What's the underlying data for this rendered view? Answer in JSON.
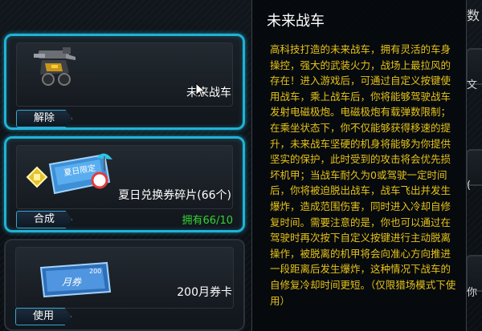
{
  "items": [
    {
      "name": "未来战车",
      "button_label": "解除",
      "icon": "mech-vehicle-icon",
      "selected": true
    },
    {
      "name": "夏日兑换券碎片(66个)",
      "button_label": "合成",
      "owned_label": "拥有66/10",
      "icon": "summer-voucher-fragment-icon",
      "badge_text": "夏日限定",
      "selected": true
    },
    {
      "name": "200月券卡",
      "button_label": "使用",
      "icon": "monthly-voucher-card-icon",
      "badge_text": "月券",
      "badge_number": "200",
      "selected": false
    }
  ],
  "tooltip": {
    "title": "未来战车",
    "description": "高科技打造的未来战车，拥有灵活的车身操控，强大的武装火力，战场上最拉风的存在！进入游戏后，可通过自定义按键使用战车，乘上战车后，你将能够驾驶战车发射电磁极炮。电磁极炮有载弹数限制；在乘坐状态下，你不仅能够获得移速的提升，未来战车坚硬的机身将能够为你提供坚实的保护，此时受到的攻击将会优先损坏机甲；当战车耐久为0或驾驶一定时间后，你将被迫脱出战车，战车飞出并发生爆炸，造成范围伤害，同时进入冷却自修复时间。需要注意的是，你也可以通过在驾驶时再次按下自定义按键进行主动脱离操作，被脱离的机甲将会向准心方向推进一段距离后发生爆炸，这种情况下战车的自修复冷却时间更短。（仅限猎场模式下使用）"
  },
  "edge_fragments": [
    "数",
    "文",
    "(",
    "你"
  ],
  "colors": {
    "selected_border": "#1fb3d6",
    "tooltip_text": "#e6c21a",
    "owned_text": "#35d335"
  }
}
